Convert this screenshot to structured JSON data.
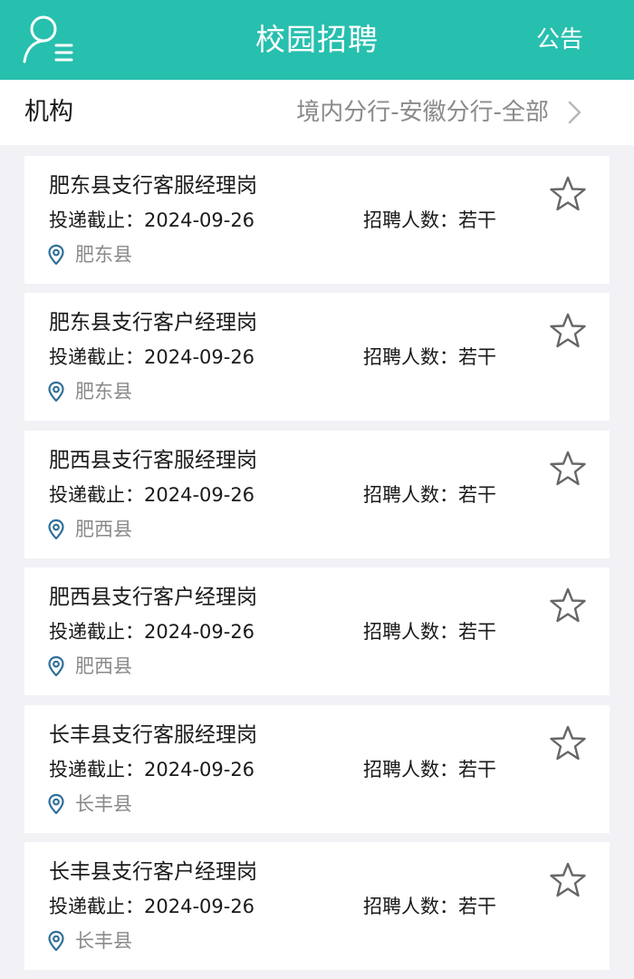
{
  "header": {
    "title": "校园招聘",
    "notice_label": "公告",
    "user_menu_icon": "user-menu-icon"
  },
  "filter": {
    "label": "机构",
    "value": "境内分行-安徽分行-全部",
    "chevron_icon": "chevron-right-icon"
  },
  "jobs": [
    {
      "title": "肥东县支行客服经理岗",
      "deadline": "投递截止：2024-09-26",
      "count": "招聘人数：若干",
      "location": "肥东县"
    },
    {
      "title": "肥东县支行客户经理岗",
      "deadline": "投递截止：2024-09-26",
      "count": "招聘人数：若干",
      "location": "肥东县"
    },
    {
      "title": "肥西县支行客服经理岗",
      "deadline": "投递截止：2024-09-26",
      "count": "招聘人数：若干",
      "location": "肥西县"
    },
    {
      "title": "肥西县支行客户经理岗",
      "deadline": "投递截止：2024-09-26",
      "count": "招聘人数：若干",
      "location": "肥西县"
    },
    {
      "title": "长丰县支行客服经理岗",
      "deadline": "投递截止：2024-09-26",
      "count": "招聘人数：若干",
      "location": "长丰县"
    },
    {
      "title": "长丰县支行客户经理岗",
      "deadline": "投递截止：2024-09-26",
      "count": "招聘人数：若干",
      "location": "长丰县"
    }
  ],
  "icons": {
    "location": "location-pin-icon",
    "favorite": "star-outline-icon"
  },
  "colors": {
    "brand": "#27bfae",
    "pin": "#2f6f98",
    "muted_text": "#8a8a8a",
    "star": "#666666"
  }
}
